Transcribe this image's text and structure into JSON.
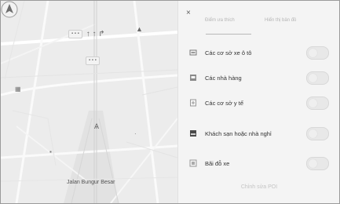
{
  "map": {
    "street_label": "Jalan Bungur Besar",
    "lane_arrows": "↑ ↑ ↱",
    "lane_sign_text": "▪ ▪ ▪",
    "lane_sign2_text": "▪ ▪ ▪"
  },
  "panel": {
    "close_label": "×",
    "tabs": [
      {
        "label": "Điểm ưa thích"
      },
      {
        "label": "Hiển thị bản đồ"
      }
    ],
    "poi_items": [
      {
        "label": "Các cơ sở xe ô tô",
        "icon": "car-dealer-icon",
        "enabled": false
      },
      {
        "label": "Các nhà hàng",
        "icon": "restaurant-icon",
        "enabled": false
      },
      {
        "label": "Các cơ sở y tế",
        "icon": "medical-icon",
        "enabled": false
      },
      {
        "label": "Khách sạn hoặc nhà nghỉ",
        "icon": "hotel-icon",
        "enabled": false
      },
      {
        "label": "Bãi đỗ xe",
        "icon": "parking-icon",
        "enabled": false
      }
    ],
    "edit_label": "Chỉnh sửa POI"
  }
}
